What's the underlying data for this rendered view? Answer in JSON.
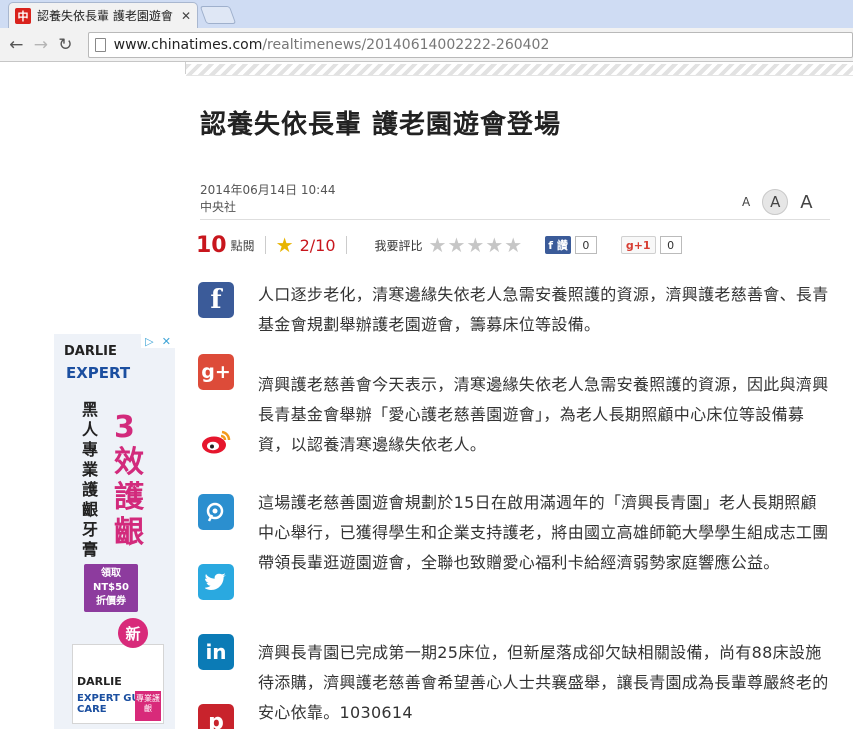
{
  "browser": {
    "tab_title": "認養失依長輩 護老園遊會",
    "tab_close": "✕",
    "favicon": "中",
    "url_host": "www.chinatimes.com",
    "url_path": "/realtimenews/20140614002222-260402"
  },
  "article": {
    "headline": "認養失依長輩 護老園遊會登場",
    "date": "2014年06月14日 10:44",
    "source": "中央社",
    "font_sizes": [
      "A",
      "A",
      "A"
    ],
    "views": "10",
    "views_label": "點閱",
    "rating": "2/10",
    "rate_label": "我要評比",
    "fb_like": "讚",
    "fb_count": "0",
    "gplus_label": "+1",
    "gplus_count": "0",
    "paragraphs": [
      "人口逐步老化，清寒邊緣失依老人急需安養照護的資源，濟興護老慈善會、長青基金會規劃舉辦護老園遊會，籌募床位等設備。",
      "濟興護老慈善會今天表示，清寒邊緣失依老人急需安養照護的資源，因此與濟興長青基金會舉辦「愛心護老慈善園遊會」，為老人長期照顧中心床位等設備募資，以認養清寒邊緣失依老人。",
      "這場護老慈善園遊會規劃於15日在啟用滿週年的「濟興長青園」老人長期照顧中心舉行，已獲得學生和企業支持護老，將由國立高雄師範大學學生組成志工團帶領長輩逛遊園遊會，全聯也致贈愛心福利卡給經濟弱勢家庭響應公益。",
      "濟興長青園已完成第一期25床位，但新屋落成卻欠缺相關設備，尚有88床設施待添購，濟興護老慈善會希望善心人士共襄盛舉，讓長青園成為長輩尊嚴終老的安心依靠。1030614"
    ]
  },
  "social_icons": [
    "facebook-icon",
    "google-plus-icon",
    "weibo-icon",
    "plurk-icon",
    "twitter-icon",
    "linkedin-icon",
    "pinterest-icon"
  ],
  "ad": {
    "brand": "DARLIE",
    "sub": "EXPERT",
    "vertical_text": "黑人專業護齦牙膏",
    "big_text": "3效護齦",
    "badge_line1": "領取",
    "badge_line2": "NT$50",
    "badge_line3": "折價券",
    "new_label": "新",
    "box_brand": "DARLIE",
    "box_line": "EXPERT GUM CARE",
    "box_pink": "專業護齦"
  }
}
